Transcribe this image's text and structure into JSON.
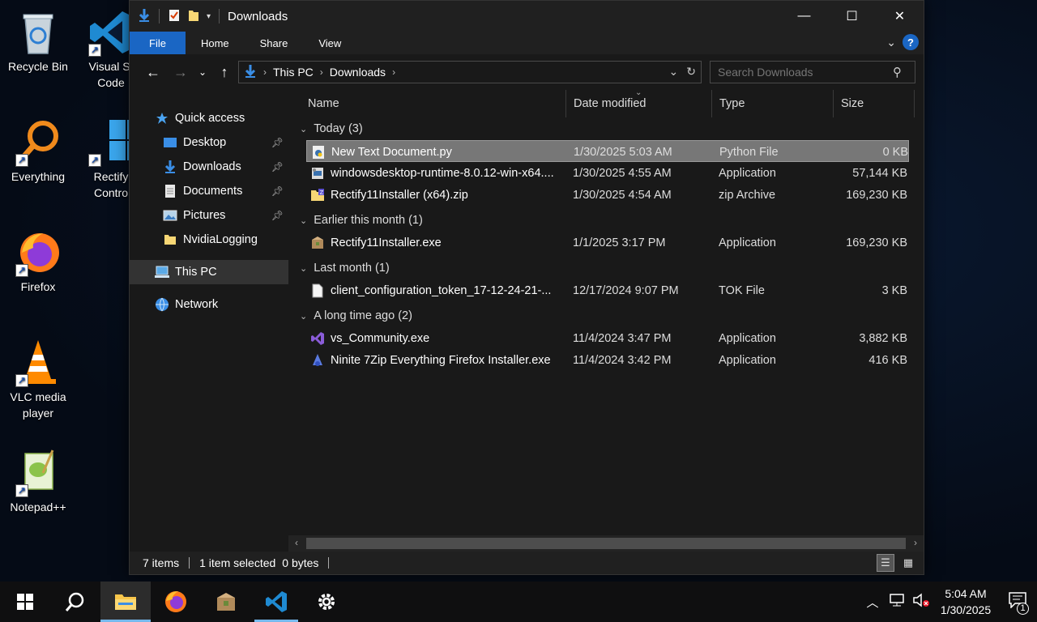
{
  "desktop": {
    "icons": [
      {
        "label": "Recycle Bin"
      },
      {
        "label": "Visual St\nCode"
      },
      {
        "label": "Everything"
      },
      {
        "label": "Rectify\nContro"
      },
      {
        "label": "Firefox"
      },
      {
        "label": "VLC media\nplayer"
      },
      {
        "label": "Notepad++"
      }
    ],
    "labels": {
      "recycle": "Recycle Bin",
      "vscode1": "Visual St",
      "vscode2": "Code",
      "everything": "Everything",
      "rectify1": "Rectify",
      "rectify2": "Contro",
      "firefox": "Firefox",
      "vlc1": "VLC media",
      "vlc2": "player",
      "notepad": "Notepad++"
    }
  },
  "window": {
    "title": "Downloads",
    "controls": {
      "minimize": "—",
      "maximize": "☐",
      "close": "✕"
    }
  },
  "ribbon": {
    "tabs": [
      {
        "label": "File"
      },
      {
        "label": "Home"
      },
      {
        "label": "Share"
      },
      {
        "label": "View"
      }
    ],
    "help": "?"
  },
  "nav": {
    "breadcrumb": [
      "This PC",
      "Downloads"
    ],
    "search_placeholder": "Search Downloads"
  },
  "sidebar": {
    "items": [
      {
        "label": "Quick access"
      },
      {
        "label": "Desktop"
      },
      {
        "label": "Downloads"
      },
      {
        "label": "Documents"
      },
      {
        "label": "Pictures"
      },
      {
        "label": "NvidiaLogging"
      },
      {
        "label": "This PC"
      },
      {
        "label": "Network"
      }
    ]
  },
  "columns": {
    "name": "Name",
    "date": "Date modified",
    "type": "Type",
    "size": "Size"
  },
  "groups": [
    {
      "label": "Today (3)",
      "files": [
        {
          "name": "New Text Document.py",
          "date": "1/30/2025 5:03 AM",
          "type": "Python File",
          "size": "0 KB"
        },
        {
          "name": "windowsdesktop-runtime-8.0.12-win-x64....",
          "date": "1/30/2025 4:55 AM",
          "type": "Application",
          "size": "57,144 KB"
        },
        {
          "name": "Rectify11Installer (x64).zip",
          "date": "1/30/2025 4:54 AM",
          "type": "zip Archive",
          "size": "169,230 KB"
        }
      ]
    },
    {
      "label": "Earlier this month (1)",
      "files": [
        {
          "name": "Rectify11Installer.exe",
          "date": "1/1/2025 3:17 PM",
          "type": "Application",
          "size": "169,230 KB"
        }
      ]
    },
    {
      "label": "Last month (1)",
      "files": [
        {
          "name": "client_configuration_token_17-12-24-21-...",
          "date": "12/17/2024 9:07 PM",
          "type": "TOK File",
          "size": "3 KB"
        }
      ]
    },
    {
      "label": "A long time ago (2)",
      "files": [
        {
          "name": "vs_Community.exe",
          "date": "11/4/2024 3:47 PM",
          "type": "Application",
          "size": "3,882 KB"
        },
        {
          "name": "Ninite 7Zip Everything Firefox Installer.exe",
          "date": "11/4/2024 3:42 PM",
          "type": "Application",
          "size": "416 KB"
        }
      ]
    }
  ],
  "status": {
    "items": "7 items",
    "selected": "1 item selected",
    "size": "0 bytes"
  },
  "taskbar": {
    "time": "5:04 AM",
    "date": "1/30/2025",
    "notifications": "1"
  },
  "colors": {
    "accent": "#1a66c4",
    "window_bg": "#191919",
    "selection": "#777777"
  }
}
